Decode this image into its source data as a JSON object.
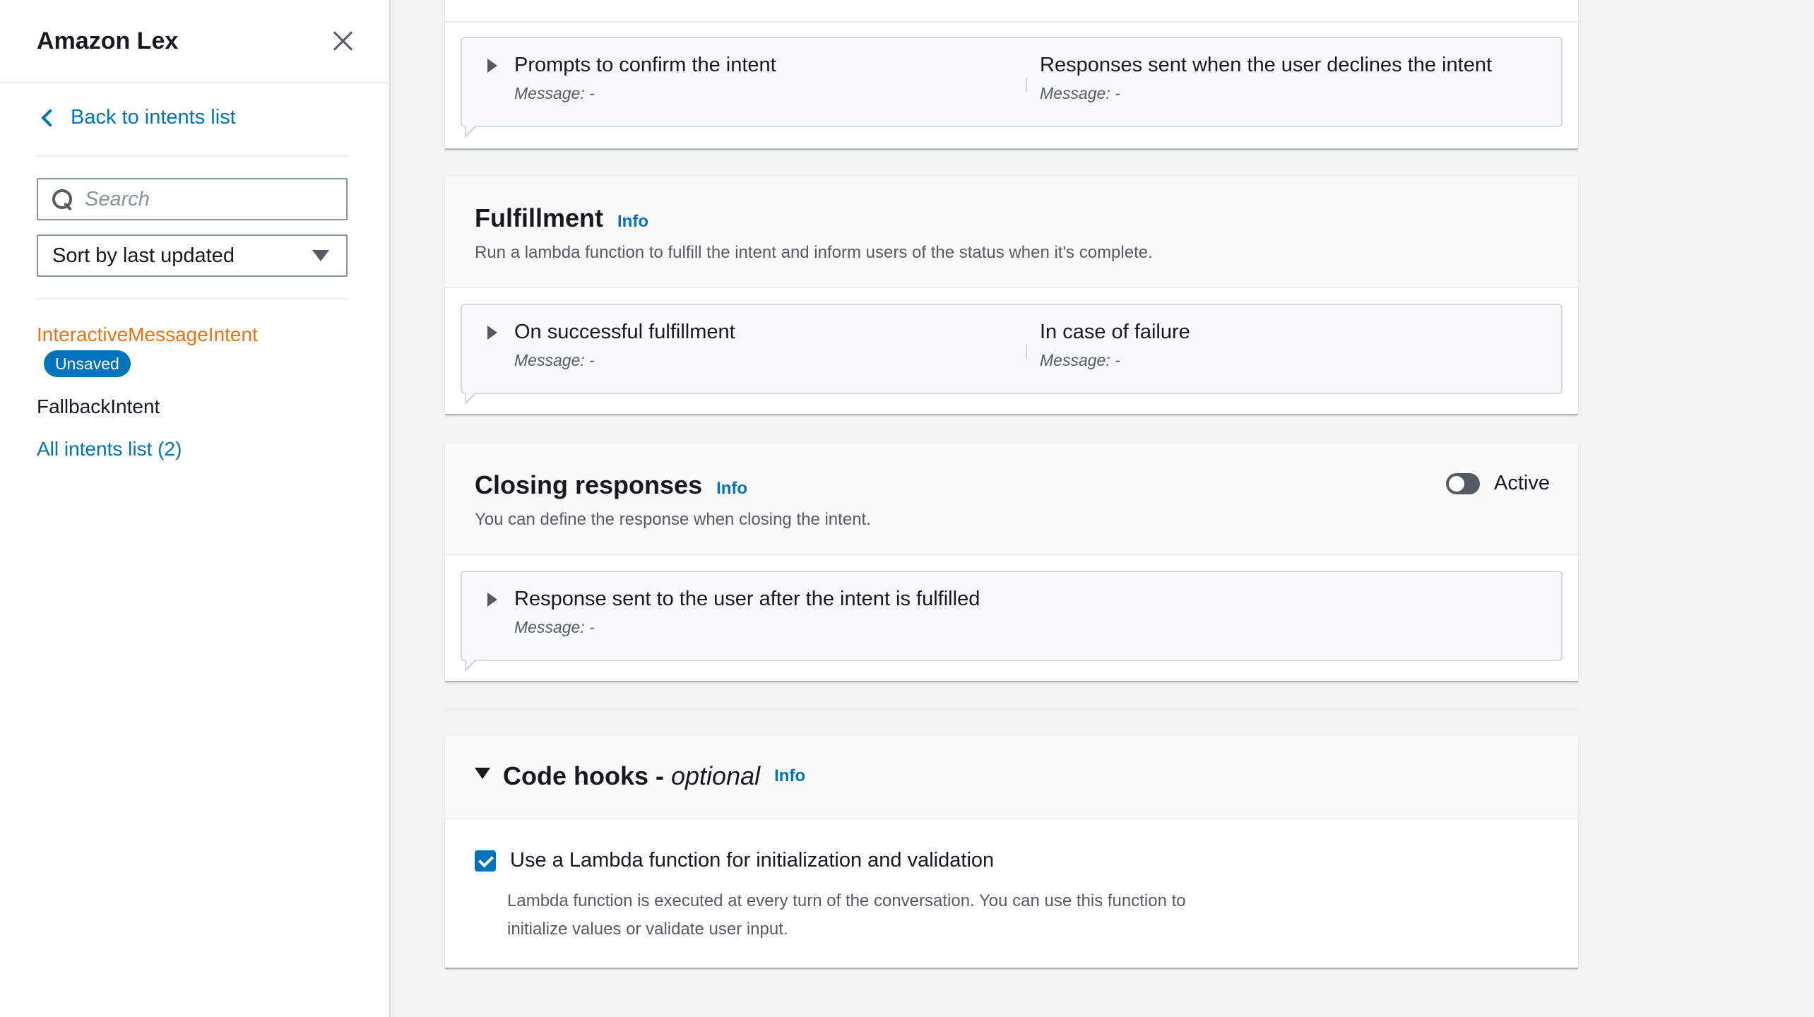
{
  "sidebar": {
    "title": "Amazon Lex",
    "back_label": "Back to intents list",
    "search_placeholder": "Search",
    "sort_label": "Sort by last updated",
    "active_intent": "InteractiveMessageIntent",
    "badge": "Unsaved",
    "other_intent": "FallbackIntent",
    "all_intents": "All intents list (2)"
  },
  "confirmation": {
    "left_title": "Prompts to confirm the intent",
    "left_message": "Message: -",
    "right_title": "Responses sent when the user declines the intent",
    "right_message": "Message: -"
  },
  "fulfillment": {
    "title": "Fulfillment",
    "info": "Info",
    "description": "Run a lambda function to fulfill the intent and inform users of the status when it's complete.",
    "left_title": "On successful fulfillment",
    "left_message": "Message: -",
    "right_title": "In case of failure",
    "right_message": "Message: -"
  },
  "closing": {
    "title": "Closing responses",
    "info": "Info",
    "description": "You can define the response when closing the intent.",
    "toggle_label": "Active",
    "toggle_on": false,
    "card_title": "Response sent to the user after the intent is fulfilled",
    "card_message": "Message: -"
  },
  "code_hooks": {
    "title": "Code hooks - ",
    "title_optional": "optional",
    "info": "Info",
    "checkbox_checked": true,
    "checkbox_label": "Use a Lambda function for initialization and validation",
    "help_line1": "Lambda function is executed at every turn of the conversation. You can use this function to",
    "help_line2": "initialize values or validate user input."
  },
  "colors": {
    "accent": "#0073bb",
    "active_intent": "#ec7211",
    "background": "#f2f3f3"
  }
}
